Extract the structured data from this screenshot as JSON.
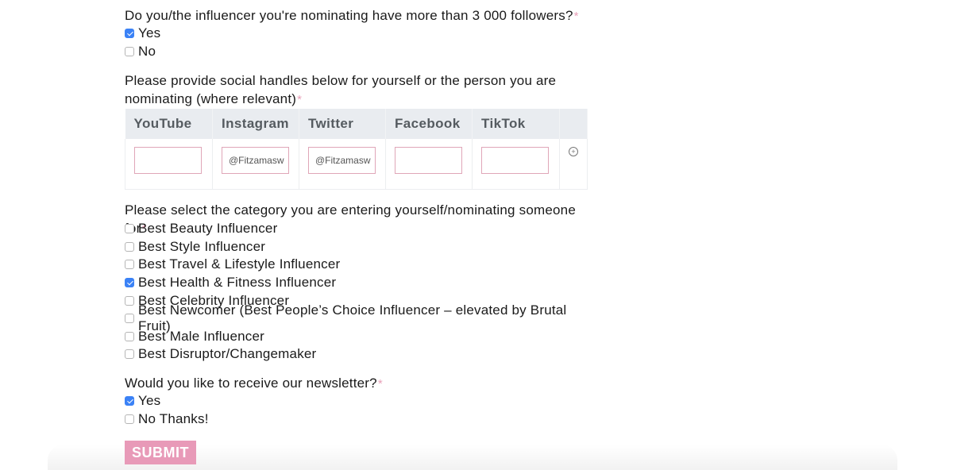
{
  "q_followers": {
    "label": "Do you/the influencer you're nominating have more than 3 000 followers?",
    "required_mark": "*",
    "options": [
      {
        "label": "Yes",
        "checked": true
      },
      {
        "label": "No",
        "checked": false
      }
    ]
  },
  "q_social": {
    "label": "Please provide social handles below for yourself or the person you are nominating (where relevant)",
    "required_mark": "*",
    "columns": [
      "YouTube",
      "Instagram",
      "Twitter",
      "Facebook",
      "TikTok"
    ],
    "values": [
      "",
      "@Fitzamasw",
      "@Fitzamasw",
      "",
      ""
    ],
    "add_row_icon": "plus-circle-icon"
  },
  "q_category": {
    "label": "Please select the category you are entering yourself/nominating someone for",
    "required_mark": "*",
    "options": [
      {
        "label": "Best Beauty Influencer",
        "checked": false
      },
      {
        "label": "Best Style Influencer",
        "checked": false
      },
      {
        "label": "Best Travel & Lifestyle Influencer",
        "checked": false
      },
      {
        "label": "Best Health & Fitness Influencer",
        "checked": true
      },
      {
        "label": "Best Celebrity Influencer",
        "checked": false
      },
      {
        "label": "Best Newcomer (Best People’s Choice Influencer – elevated by Brutal Fruit)",
        "checked": false
      },
      {
        "label": "Best Male Influencer",
        "checked": false
      },
      {
        "label": "Best Disruptor/Changemaker",
        "checked": false
      }
    ]
  },
  "q_newsletter": {
    "label": "Would you like to receive our newsletter?",
    "required_mark": "*",
    "options": [
      {
        "label": "Yes",
        "checked": true
      },
      {
        "label": "No Thanks!",
        "checked": false
      }
    ]
  },
  "submit": {
    "label": "SUBMIT",
    "color": "#e89ab8"
  },
  "colors": {
    "required": "#e8a0b8",
    "checkbox_checked": "#3b82f6",
    "input_border": "#e0a6b8",
    "table_header_bg": "#e9ecf0"
  }
}
